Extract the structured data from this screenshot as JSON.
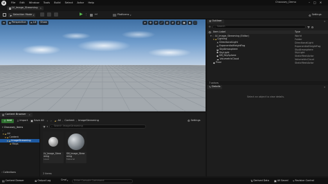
{
  "menu": {
    "items": [
      "File",
      "Edit",
      "Window",
      "Tools",
      "Build",
      "Select",
      "Actor",
      "Help"
    ],
    "level_tab": "LV_Image_Streaming",
    "project_name": "Chaussey_Demo"
  },
  "toolbar": {
    "mode_label": "Selection Mode",
    "platforms_label": "Platforms",
    "settings_label": "Settings"
  },
  "viewport": {
    "perspective": "Perspective",
    "lit": "Lit",
    "show": "Show"
  },
  "outliner": {
    "tab": "Outliner",
    "search_placeholder": "Search",
    "col_label": "Item Label",
    "col_type": "Type",
    "rows": [
      {
        "label": "LV_Image_Streaming (Editor)",
        "type": "World"
      },
      {
        "label": "Lighting",
        "type": "Folder"
      },
      {
        "label": "DirectionalLight",
        "type": "DirectionalLight"
      },
      {
        "label": "ExponentialHeightFog",
        "type": "ExponentialHeightFog"
      },
      {
        "label": "SkyAtmosphere",
        "type": "SkyAtmosphere"
      },
      {
        "label": "SkyLight",
        "type": "SkyLight"
      },
      {
        "label": "SM_SkySphere",
        "type": "StaticMeshActor"
      },
      {
        "label": "VolumetricCloud",
        "type": "VolumetricCloud"
      },
      {
        "label": "Floor",
        "type": "StaticMeshActor"
      }
    ],
    "actor_count": "7 actors"
  },
  "details": {
    "tab": "Details",
    "placeholder": "Select an object to view details."
  },
  "content_browser": {
    "tab": "Content Browser",
    "add": "Add",
    "import": "Import",
    "save_all": "Save All",
    "path": [
      "All",
      "Content",
      "ImageStreaming"
    ],
    "settings": "Settings",
    "project_root": "Chaussey_Items",
    "tree": [
      "All",
      "Content",
      "ImageStreaming",
      "Maps"
    ],
    "search_placeholder": "Search ImageStreaming",
    "assets": [
      {
        "name": "LV_Image_Streaming",
        "type": "Level"
      },
      {
        "name": "SM_Image_Streaming",
        "type": "Material"
      }
    ],
    "collections": "Collections",
    "item_count": "2 items"
  },
  "statusbar": {
    "drawer": "Content Drawer",
    "output_log": "Output Log",
    "cmd": "Cmd",
    "console_placeholder": "Enter Console Command",
    "derived_data": "Derived Data",
    "all_saved": "All Saved",
    "revision_control": "Revision Control"
  }
}
